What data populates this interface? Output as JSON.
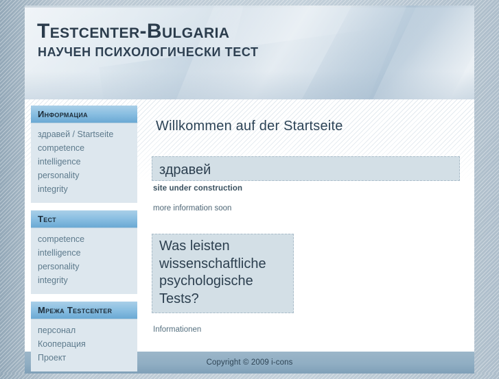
{
  "header": {
    "site_title": "Testcenter-Bulgaria",
    "site_subtitle": "НАУЧЕН ПСИХОЛОГИЧЕСКИ ТЕСТ"
  },
  "sidebar": {
    "blocks": [
      {
        "title": "Информациа",
        "items": [
          {
            "label": "здравей / Startseite"
          },
          {
            "label": "competence"
          },
          {
            "label": "intelligence"
          },
          {
            "label": "personality"
          },
          {
            "label": "integrity"
          }
        ]
      },
      {
        "title": "Тест",
        "items": [
          {
            "label": "competence"
          },
          {
            "label": "intelligence"
          },
          {
            "label": "personality"
          },
          {
            "label": "integrity"
          }
        ]
      },
      {
        "title": "Мрежа Testcenter",
        "items": [
          {
            "label": "персонал"
          },
          {
            "label": "Кооперация"
          },
          {
            "label": "Проект"
          }
        ]
      }
    ]
  },
  "main": {
    "page_heading": "Willkommen auf der Startseite",
    "welcome_box": "здравей",
    "under_construction": "site under construction",
    "more_info": "more information soon",
    "question_box": "Was leisten wissenschaftliche psychologische Tests?",
    "informationen": "Informationen"
  },
  "footer": {
    "copyright": "Copyright © 2009 i-cons"
  },
  "colors": {
    "page_background": "#b6c4cf",
    "nav_header_top": "#a9cfe8",
    "nav_header_bottom": "#6aa9d4",
    "nav_block_body": "#dde7ee",
    "nav_link": "#5d7a8c",
    "highlight_box": "#d3dfe6",
    "heading_text": "#2c4356",
    "footer_background": "#90aec3",
    "brand_text": "#2b3c4c"
  }
}
